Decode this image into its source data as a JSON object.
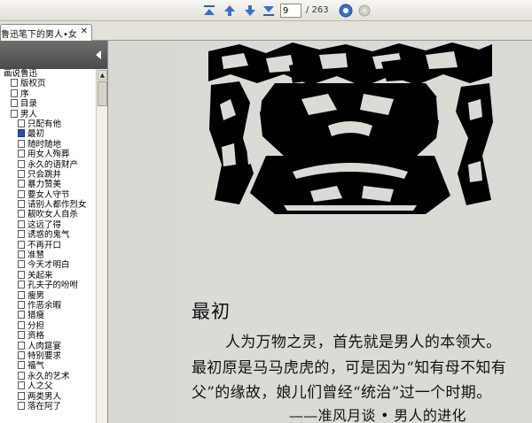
{
  "toolbar": {
    "page_current": "9",
    "page_total": "/ 263",
    "buttons": [
      "first-page-icon",
      "prev-page-icon",
      "next-page-icon",
      "last-page-icon",
      "go-icon",
      "stop-icon"
    ]
  },
  "tab": {
    "label": "鲁迅笔下的男人•女...",
    "close": "✕"
  },
  "sidebar": {
    "items": [
      {
        "label": "画说鲁迅",
        "indent": 0,
        "icon": false
      },
      {
        "label": "版权页",
        "indent": 1,
        "icon": true
      },
      {
        "label": "序",
        "indent": 1,
        "icon": true
      },
      {
        "label": "目录",
        "indent": 1,
        "icon": true
      },
      {
        "label": "男人",
        "indent": 1,
        "icon": true
      },
      {
        "label": "只配有他",
        "indent": 2,
        "icon": true
      },
      {
        "label": "最初",
        "indent": 2,
        "icon": true,
        "selected": true
      },
      {
        "label": "随时随地",
        "indent": 2,
        "icon": true
      },
      {
        "label": "用女人殉葬",
        "indent": 2,
        "icon": true
      },
      {
        "label": "永久的语财产",
        "indent": 2,
        "icon": true
      },
      {
        "label": "只会跳井",
        "indent": 2,
        "icon": true
      },
      {
        "label": "暴力赞美",
        "indent": 2,
        "icon": true
      },
      {
        "label": "要女人守节",
        "indent": 2,
        "icon": true
      },
      {
        "label": "请别人都作烈女",
        "indent": 2,
        "icon": true
      },
      {
        "label": "靓吹女人自杀",
        "indent": 2,
        "icon": true
      },
      {
        "label": "这远了得",
        "indent": 2,
        "icon": true
      },
      {
        "label": "诱惑的鬼气",
        "indent": 2,
        "icon": true
      },
      {
        "label": "不再开口",
        "indent": 2,
        "icon": true
      },
      {
        "label": "准慧",
        "indent": 2,
        "icon": true
      },
      {
        "label": "今天才明白",
        "indent": 2,
        "icon": true
      },
      {
        "label": "关起来",
        "indent": 2,
        "icon": true
      },
      {
        "label": "孔夫子的吩咐",
        "indent": 2,
        "icon": true
      },
      {
        "label": "瘦男",
        "indent": 2,
        "icon": true
      },
      {
        "label": "作恶余暇",
        "indent": 2,
        "icon": true
      },
      {
        "label": "猎瘦",
        "indent": 2,
        "icon": true
      },
      {
        "label": "分担",
        "indent": 2,
        "icon": true
      },
      {
        "label": "资格",
        "indent": 2,
        "icon": true
      },
      {
        "label": "人肉筵宴",
        "indent": 2,
        "icon": true
      },
      {
        "label": "特别要求",
        "indent": 2,
        "icon": true
      },
      {
        "label": "福气",
        "indent": 2,
        "icon": true
      },
      {
        "label": "永久的艺术",
        "indent": 2,
        "icon": true
      },
      {
        "label": "人之父",
        "indent": 2,
        "icon": true
      },
      {
        "label": "两类男人",
        "indent": 2,
        "icon": true
      },
      {
        "label": "落在阿了",
        "indent": 2,
        "icon": true
      }
    ]
  },
  "document": {
    "chapter_title": "最初",
    "lines": [
      "人为万物之灵，首先就是男人的本领大。",
      "最初原是马马虎虎的，可是因为“知有母不知有",
      "父”的缘故，娘儿们曾经“统治”过一个时期。",
      "——准风月谈 • 男人的进化"
    ]
  }
}
